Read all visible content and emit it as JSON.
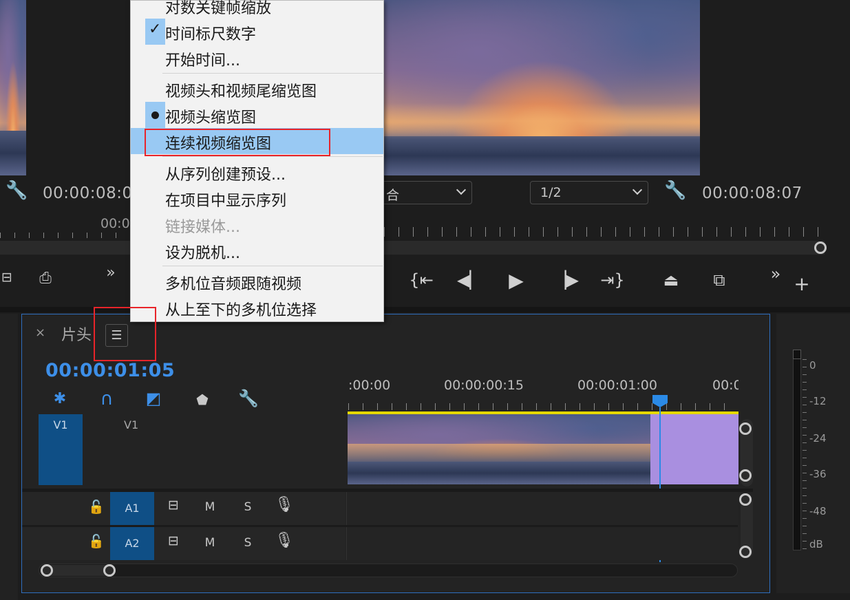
{
  "source_monitor": {
    "timecode": "00:00:08:0",
    "ruler_timecode": "00:0"
  },
  "program_monitor": {
    "fit_dropdown": "合",
    "resolution_dropdown": "1/2",
    "timecode": "00:00:08:07"
  },
  "context_menu": {
    "items": [
      {
        "label": "对数关键帧缩放",
        "state": "none",
        "enabled": true
      },
      {
        "label": "时间标尺数字",
        "state": "checked",
        "enabled": true
      },
      {
        "label": "开始时间...",
        "state": "none",
        "enabled": true
      },
      {
        "label": "视频头和视频尾缩览图",
        "state": "none",
        "enabled": true
      },
      {
        "label": "视频头缩览图",
        "state": "radio",
        "enabled": true
      },
      {
        "label": "连续视频缩览图",
        "state": "highlighted",
        "enabled": true
      },
      {
        "label": "从序列创建预设...",
        "state": "none",
        "enabled": true
      },
      {
        "label": "在项目中显示序列",
        "state": "none",
        "enabled": true
      },
      {
        "label": "链接媒体...",
        "state": "none",
        "enabled": false
      },
      {
        "label": "设为脱机...",
        "state": "none",
        "enabled": true
      },
      {
        "label": "多机位音频跟随视频",
        "state": "none",
        "enabled": true
      },
      {
        "label": "从上至下的多机位选择",
        "state": "none",
        "enabled": true
      }
    ]
  },
  "timeline": {
    "close_label": "×",
    "sequence_name": "片头",
    "menu_icon": "☰",
    "current_timecode": "00:00:01:05",
    "ruler_labels": [
      ":00:00",
      "00:00:00:15",
      "00:00:01:00",
      "00:0"
    ],
    "tracks": {
      "v1_source": "V1",
      "v1_target": "V1",
      "a1": "A1",
      "a2": "A2",
      "mute": "M",
      "solo": "S"
    }
  },
  "audio_meter": {
    "labels": [
      "0",
      "-12",
      "-24",
      "-36",
      "-48",
      "dB"
    ]
  },
  "colors": {
    "accent_blue": "#2b8ae6",
    "highlight": "#99c9f3",
    "annotation_red": "#e8242a",
    "clip_purple": "#a98fe0",
    "work_area_yellow": "#e5d800"
  }
}
